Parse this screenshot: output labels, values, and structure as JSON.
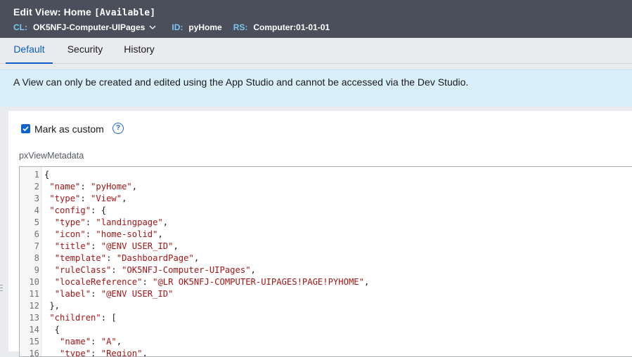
{
  "header": {
    "title": "Edit  View: Home",
    "status": "[Available]",
    "cl_label": "CL:",
    "cl_value": "OK5NFJ-Computer-UIPages",
    "id_label": "ID:",
    "id_value": "pyHome",
    "rs_label": "RS:",
    "rs_value": "Computer:01-01-01"
  },
  "tabs": [
    {
      "label": "Default",
      "active": true
    },
    {
      "label": "Security",
      "active": false
    },
    {
      "label": "History",
      "active": false
    }
  ],
  "banner": {
    "text": "A View can only be created and edited using the App Studio and cannot be accessed via the Dev Studio."
  },
  "form": {
    "checkbox_label": "Mark as custom",
    "checkbox_checked": true,
    "help_icon": "question-circle-icon",
    "field_label": "pxViewMetadata"
  },
  "editor": {
    "lines": [
      {
        "n": "1",
        "code": "{"
      },
      {
        "n": "2",
        "code": " \"name\": \"pyHome\","
      },
      {
        "n": "3",
        "code": " \"type\": \"View\","
      },
      {
        "n": "4",
        "code": " \"config\": {"
      },
      {
        "n": "5",
        "code": "  \"type\": \"landingpage\","
      },
      {
        "n": "6",
        "code": "  \"icon\": \"home-solid\","
      },
      {
        "n": "7",
        "code": "  \"title\": \"@ENV USER_ID\","
      },
      {
        "n": "8",
        "code": "  \"template\": \"DashboardPage\","
      },
      {
        "n": "9",
        "code": "  \"ruleClass\": \"OK5NFJ-Computer-UIPages\","
      },
      {
        "n": "10",
        "code": "  \"localeReference\": \"@LR OK5NFJ-COMPUTER-UIPAGES!PAGE!PYHOME\","
      },
      {
        "n": "11",
        "code": "  \"label\": \"@ENV USER_ID\""
      },
      {
        "n": "12",
        "code": " },"
      },
      {
        "n": "13",
        "code": " \"children\": ["
      },
      {
        "n": "14",
        "code": "  {"
      },
      {
        "n": "15",
        "code": "   \"name\": \"A\","
      },
      {
        "n": "16",
        "code": "   \"type\": \"Region\","
      }
    ]
  },
  "colors": {
    "header_bg": "#4a4f5b",
    "accent": "#0b5fc2",
    "meta_label": "#7ec7ee",
    "banner_bg": "#d8eef9",
    "string": "#a31515"
  }
}
